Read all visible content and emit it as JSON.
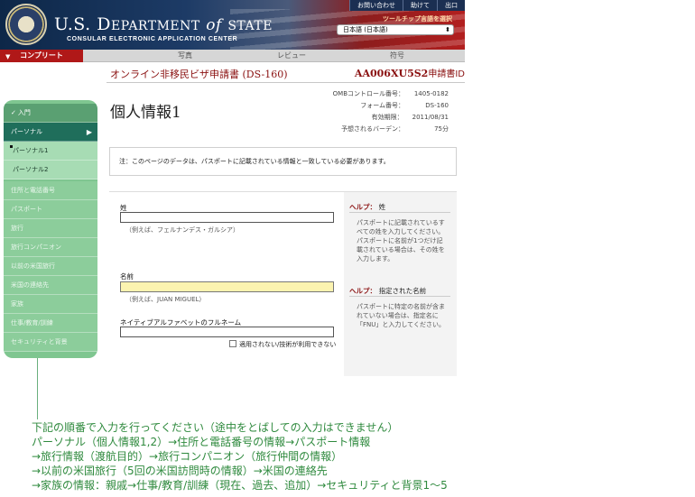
{
  "header": {
    "dept_title_a": "U.S. D",
    "dept_title_b": "EPARTMENT",
    "dept_title_of": "of",
    "dept_title_c": "STATE",
    "subtitle": "CONSULAR ELECTRONIC APPLICATION CENTER",
    "links": [
      "お問い合わせ",
      "助けて",
      "出口"
    ],
    "tooltip_lang_label": "ツールチップ言語を選択",
    "lang_selected": "日本語 (日本語)"
  },
  "progress": {
    "steps": [
      "コンプリート",
      "写真",
      "レビュー",
      "符号"
    ]
  },
  "form_title": "オンライン非移民ビザ申請書 (DS-160)",
  "app_id": {
    "code": "AA006XU5S2",
    "label": "申請書ID"
  },
  "page_heading": "個人情報1",
  "meta": [
    {
      "k": "OMBコントロール番号：",
      "v": "1405-0182"
    },
    {
      "k": "フォーム番号：",
      "v": "DS-160"
    },
    {
      "k": "有効期限：",
      "v": "2011/08/31"
    },
    {
      "k": "予想されるバーデン：",
      "v": "75分"
    }
  ],
  "notice": "注：このページのデータは、パスポートに記載されている情報と一致している必要があります。",
  "form": {
    "surname_label": "姓",
    "surname_hint": "（例えば、フェルナンデス・ガルシア）",
    "given_label": "名前",
    "given_hint": "（例えば、JUAN MIGUEL）",
    "native_label": "ネイティブアルファベットのフルネーム",
    "na_label": "適用されない/技術が利用できない"
  },
  "help": {
    "surname_head": "ヘルプ：",
    "surname_topic": "姓",
    "surname_text": "パスポートに記載されているすべての姓を入力してください。パスポートに名前が1つだけ記載されている場合は、その姓を入力します。",
    "given_head": "ヘルプ：",
    "given_topic": "指定された名前",
    "given_text": "パスポートに特定の名前が含まれていない場合は、指定名に「FNU」と入力してください。"
  },
  "sidebar": {
    "items": [
      "入門",
      "パーソナル",
      "パーソナル1",
      "パーソナル2",
      "住所と電話番号",
      "パスポート",
      "旅行",
      "旅行コンパニオン",
      "以前の米国旅行",
      "米国の連絡先",
      "家族",
      "仕事/教育/訓練",
      "セキュリティと背景"
    ]
  },
  "instructions": [
    "下記の順番で入力を行ってください（途中をとばしての入力はできません）",
    "パーソナル（個人情報1,2）→住所と電話番号の情報→パスポート情報",
    "→旅行情報（渡航目的）→旅行コンパニオン（旅行仲間の情報）",
    "→以前の米国旅行（5回の米国訪問時の情報）→米国の連絡先",
    "→家族の情報：親戚→仕事/教育/訓練（現在、過去、追加）→セキュリティと背景1〜5"
  ],
  "colors": {
    "accent_red": "#b01818",
    "sidebar_green": "#7fc690",
    "instruction_green": "#2f8a3e"
  },
  "icons": {
    "seal": "seal-icon",
    "check": "check-icon",
    "chevron": "chevron-right-icon"
  }
}
